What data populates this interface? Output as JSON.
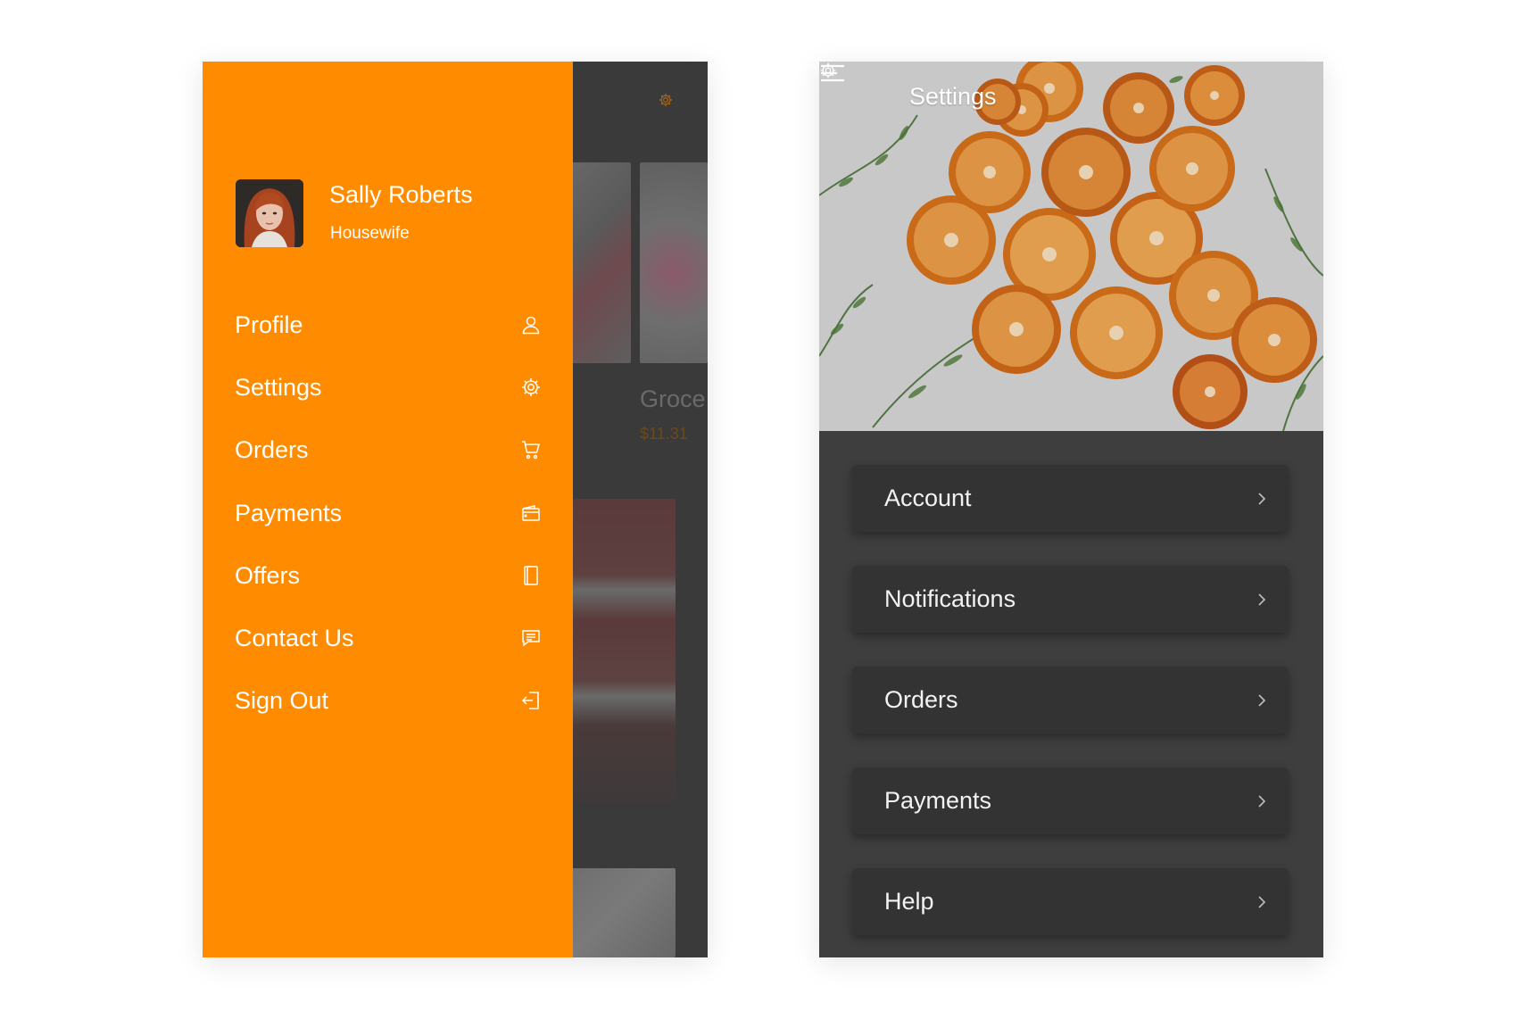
{
  "colors": {
    "accent": "#ff8c00",
    "dark_bg": "#3e3e3e",
    "card_bg": "#333333",
    "text_light": "#ffffff"
  },
  "drawer": {
    "user": {
      "name": "Sally Roberts",
      "role": "Housewife"
    },
    "items": [
      {
        "label": "Profile",
        "icon": "user-icon"
      },
      {
        "label": "Settings",
        "icon": "gear-icon"
      },
      {
        "label": "Orders",
        "icon": "cart-icon"
      },
      {
        "label": "Payments",
        "icon": "wallet-icon"
      },
      {
        "label": "Offers",
        "icon": "booklet-icon"
      },
      {
        "label": "Contact Us",
        "icon": "chat-icon"
      },
      {
        "label": "Sign Out",
        "icon": "sign-out-icon"
      }
    ]
  },
  "background_screen": {
    "card_title": "Groce",
    "card_price": "$11.31"
  },
  "settings_screen": {
    "title": "Settings",
    "items": [
      {
        "label": "Account"
      },
      {
        "label": "Notifications"
      },
      {
        "label": "Orders"
      },
      {
        "label": "Payments"
      },
      {
        "label": "Help"
      }
    ]
  }
}
